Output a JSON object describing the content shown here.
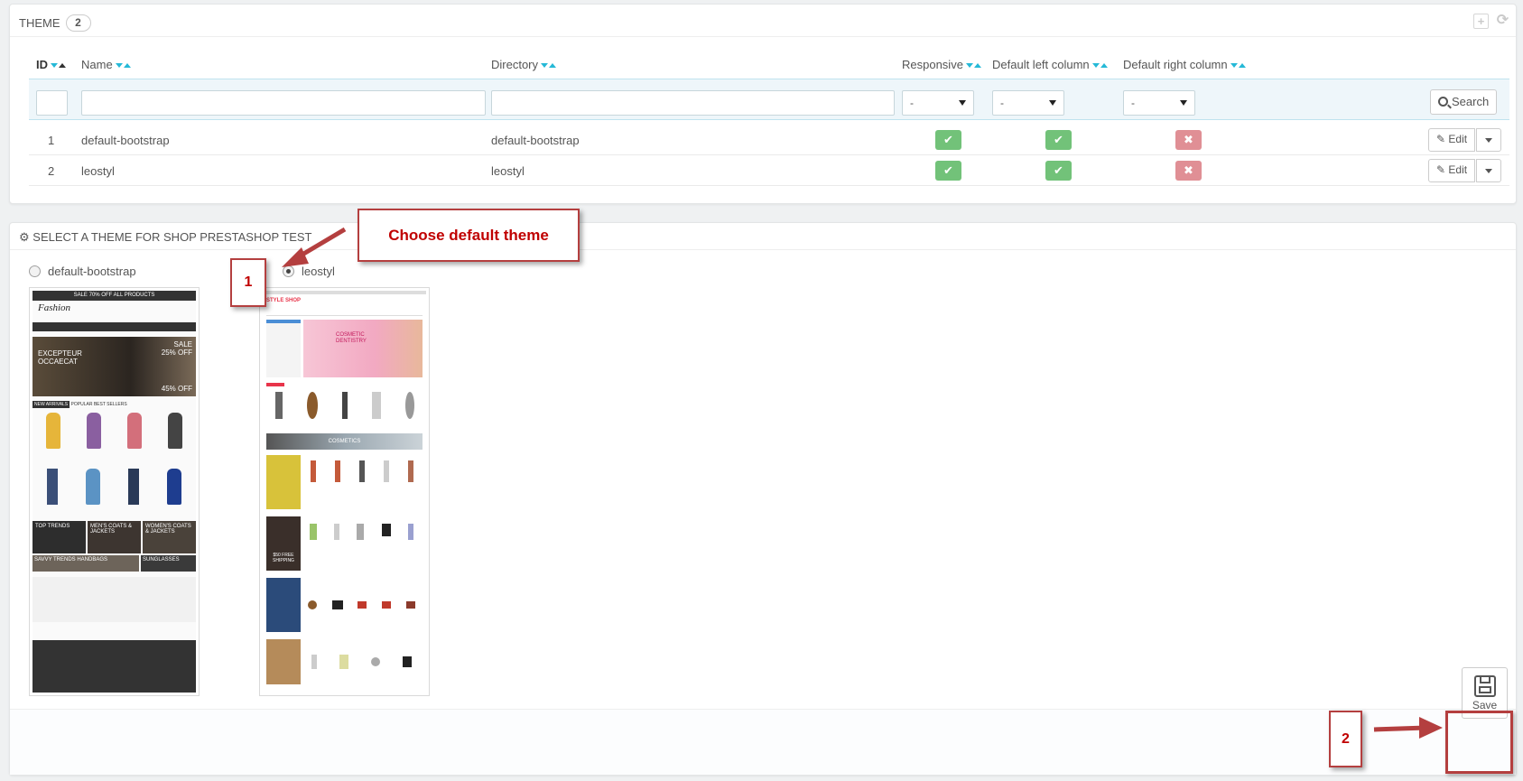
{
  "list_panel": {
    "title": "THEME",
    "count": "2",
    "columns": {
      "id": "ID",
      "name": "Name",
      "directory": "Directory",
      "responsive": "Responsive",
      "left_column": "Default left column",
      "right_column": "Default right column"
    },
    "filter_select_value": "-",
    "search_label": "Search",
    "rows": [
      {
        "id": "1",
        "name": "default-bootstrap",
        "directory": "default-bootstrap",
        "responsive": true,
        "left": true,
        "right": false,
        "edit_label": "Edit"
      },
      {
        "id": "2",
        "name": "leostyl",
        "directory": "leostyl",
        "responsive": true,
        "left": true,
        "right": false,
        "edit_label": "Edit"
      }
    ]
  },
  "select_panel": {
    "title": "SELECT A THEME FOR SHOP PRESTASHOP TEST",
    "themes": [
      {
        "name": "default-bootstrap",
        "selected": false
      },
      {
        "name": "leostyl",
        "selected": true
      }
    ],
    "save_label": "Save"
  },
  "thumb_default": {
    "banner": "SALE 70% OFF ALL PRODUCTS",
    "logo": "Fashion",
    "hero_title": "EXCEPTEUR OCCAECAT",
    "promo1": "SALE 25% OFF",
    "promo2": "45% OFF",
    "tabs": [
      "NEW ARRIVALS",
      "POPULAR",
      "BEST SELLERS"
    ],
    "cat1": "TOP TRENDS",
    "cat2": "MEN'S COATS & JACKETS",
    "cat3": "WOMEN'S COATS & JACKETS",
    "cat4": "SAVVY TRENDS HANDBAGS",
    "cat5": "SUNGLASSES"
  },
  "thumb_leo": {
    "logo": "STYLE SHOP",
    "hero_title": "COSMETIC DENTISTRY",
    "mid_banner": "COSMETICS",
    "free_shipping": "$50 FREE SHIPPING"
  },
  "annotations": {
    "callout_text": "Choose default theme",
    "step1": "1",
    "step2": "2"
  },
  "colors": {
    "accent": "#25b9d7",
    "status_on": "#72c279",
    "status_off": "#e08f95",
    "annotation": "#c00000"
  }
}
